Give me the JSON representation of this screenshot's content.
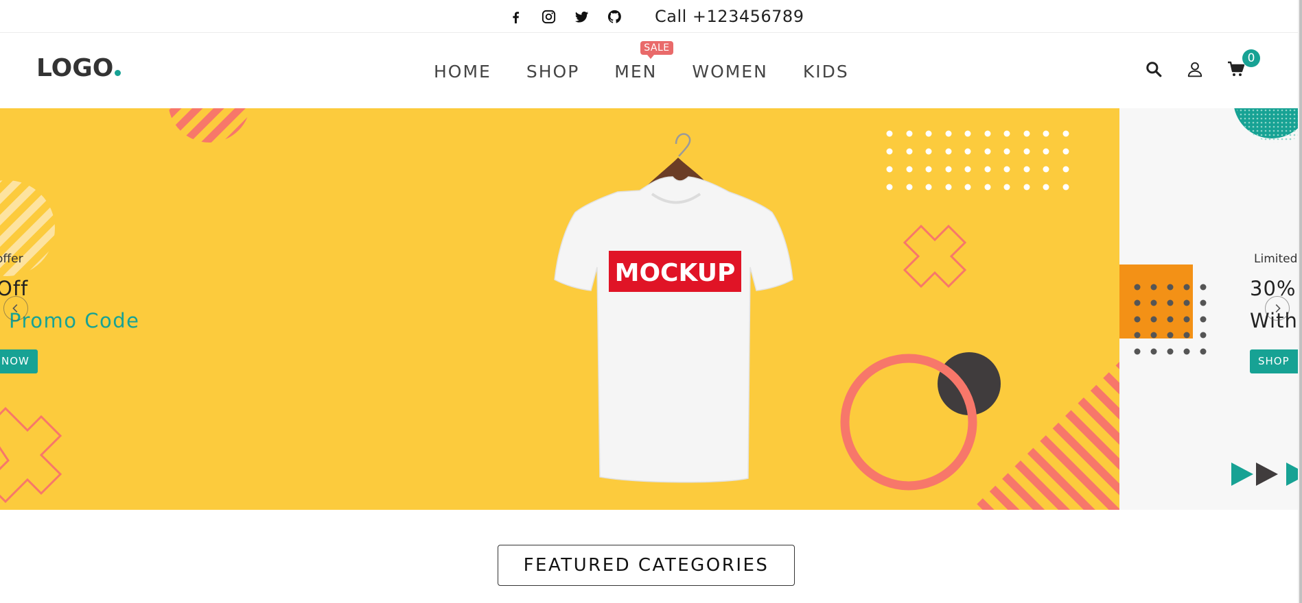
{
  "topbar": {
    "social": [
      "facebook-icon",
      "instagram-icon",
      "twitter-icon",
      "github-icon"
    ],
    "call_text": "Call +123456789"
  },
  "header": {
    "logo_text": "LOGO",
    "nav": [
      {
        "label": "HOME"
      },
      {
        "label": "SHOP"
      },
      {
        "label": "MEN",
        "badge": "SALE"
      },
      {
        "label": "WOMEN"
      },
      {
        "label": "KIDS"
      }
    ],
    "icons": [
      "search-icon",
      "user-icon",
      "cart-icon"
    ],
    "cart_count": "0"
  },
  "slider": {
    "prev_slide": {
      "eyebrow": "offer",
      "headline": "Off",
      "promo": "Promo Code",
      "button": "NOW"
    },
    "current_slide": {
      "shirt_print": "MOCKUP"
    },
    "next_slide": {
      "eyebrow": "Limited",
      "headline_1": "30%",
      "headline_2": "With",
      "button": "SHOP"
    }
  },
  "featured": {
    "title": "FEATURED CATEGORIES"
  },
  "colors": {
    "accent": "#17a294",
    "hero_bg": "#fccb3d",
    "coral": "#f7776a",
    "sale_badge": "#e96a6a"
  }
}
